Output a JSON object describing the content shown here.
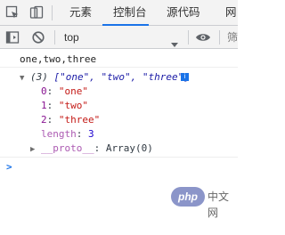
{
  "tabs": [
    {
      "label": "元素",
      "active": false
    },
    {
      "label": "控制台",
      "active": true
    },
    {
      "label": "源代码",
      "active": false
    },
    {
      "label": "网",
      "active": false
    }
  ],
  "toolbar": {
    "context": "top",
    "filter": "筛"
  },
  "console": {
    "log_output": "one,two,three",
    "array_summary_prefix": "(3) ",
    "array_summary": "[\"one\", \"two\", \"three\"]",
    "items": [
      {
        "key": "0",
        "value": "\"one\""
      },
      {
        "key": "1",
        "value": "\"two\""
      },
      {
        "key": "2",
        "value": "\"three\""
      }
    ],
    "length": {
      "key": "length",
      "value": "3"
    },
    "proto": {
      "key": "__proto__",
      "value": "Array(0)"
    },
    "prompt_symbol": ">"
  },
  "watermark": {
    "logo": "php",
    "text": "中文网"
  },
  "colors": {
    "accent": "#1a73e8",
    "string": "#c41a16",
    "number": "#1c00cf",
    "key": "#881391"
  }
}
